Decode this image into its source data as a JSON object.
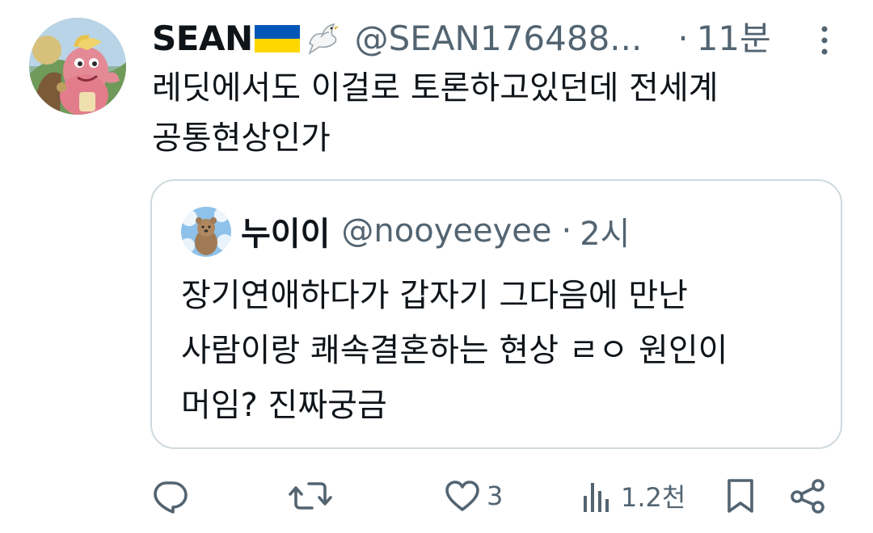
{
  "author": {
    "display_name": "SEAN",
    "handle": "@SEAN176488...",
    "separator": "·",
    "time": "11분"
  },
  "tweet_text": "레딧에서도 이걸로 토론하고있던데 전세계\n공통현상인가",
  "quoted": {
    "display_name": "누이이",
    "handle": "@nooyeeyee",
    "separator": "·",
    "time": "2시",
    "text": "장기연애하다가 갑자기 그다음에 만난\n사람이랑 쾌속결혼하는 현상 ㄹㅇ 원인이\n머임? 진짜궁금"
  },
  "actions": {
    "reply_count": "",
    "repost_count": "",
    "like_count": "3",
    "views_count": "1.2천"
  },
  "icons": {
    "more": "more-vertical-icon",
    "reply": "reply-icon",
    "repost": "repost-icon",
    "like": "heart-icon",
    "views": "views-icon",
    "bookmark": "bookmark-icon",
    "share": "share-icon"
  },
  "colors": {
    "text_primary": "#0f1419",
    "text_secondary": "#536471",
    "border": "#cfd9de",
    "flag_blue": "#0057b7",
    "flag_yellow": "#ffd700"
  }
}
